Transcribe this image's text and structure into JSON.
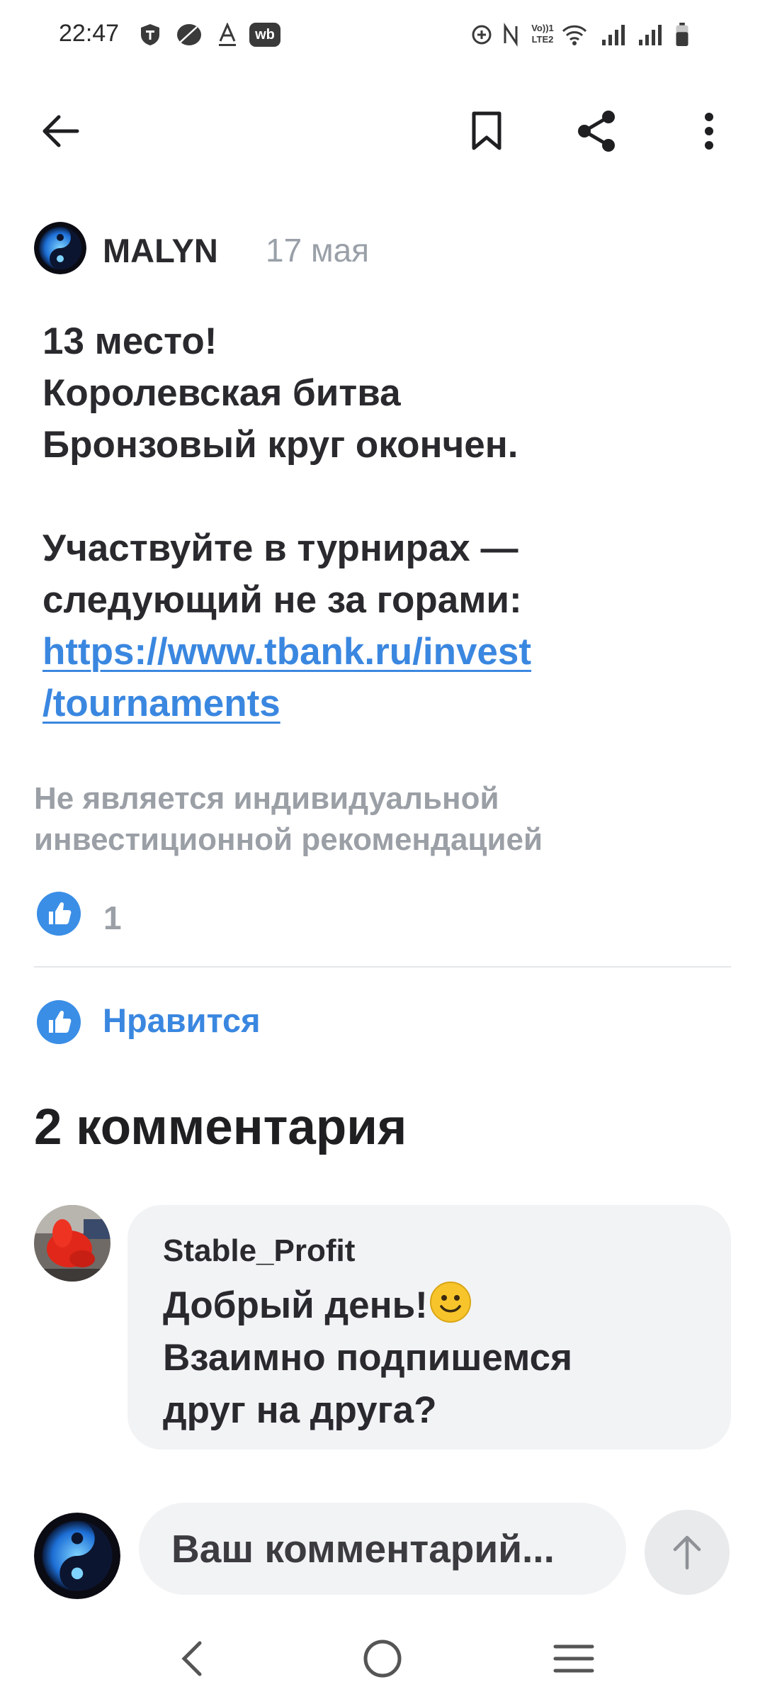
{
  "status_bar": {
    "time": "22:47",
    "icons": [
      "shield-t-icon",
      "leaf-icon",
      "font-a-icon",
      "wb-icon",
      "data-saver-icon",
      "nfc-icon",
      "volte-icon",
      "wifi-icon",
      "signal-icon",
      "signal-icon",
      "battery-icon"
    ],
    "volte_text": "Vo))1",
    "lte_text": "LTE2",
    "wb_text": "wb"
  },
  "app_bar": {
    "icons": [
      "back-arrow-icon",
      "bookmark-icon",
      "share-icon",
      "more-vertical-icon"
    ]
  },
  "post": {
    "author": "MALYN",
    "date": "17 мая",
    "lines": [
      "13 место!",
      "Королевская битва",
      "Бронзовый круг окончен."
    ],
    "lines2": [
      "Участвуйте в турнирах —",
      "следующий не за горами:"
    ],
    "link_lines": [
      "https://www.tbank.ru/invest",
      "/tournaments"
    ],
    "disclaimer_lines": [
      "Не является индивидуальной",
      "инвестиционной рекомендацией"
    ],
    "reaction_count": "1",
    "like_label": "Нравится"
  },
  "comments": {
    "title": "2 комментария",
    "items": [
      {
        "author": "Stable_Profit",
        "line1": "Добрый день!",
        "line2": "Взаимно подпишемся",
        "line3": "друг на друга?"
      }
    ]
  },
  "composer": {
    "placeholder": "Ваш комментарий..."
  },
  "colors": {
    "accent": "#3a87e0",
    "text": "#2a2a2e",
    "muted": "#9b9fa6",
    "bubble": "#f2f3f5"
  }
}
